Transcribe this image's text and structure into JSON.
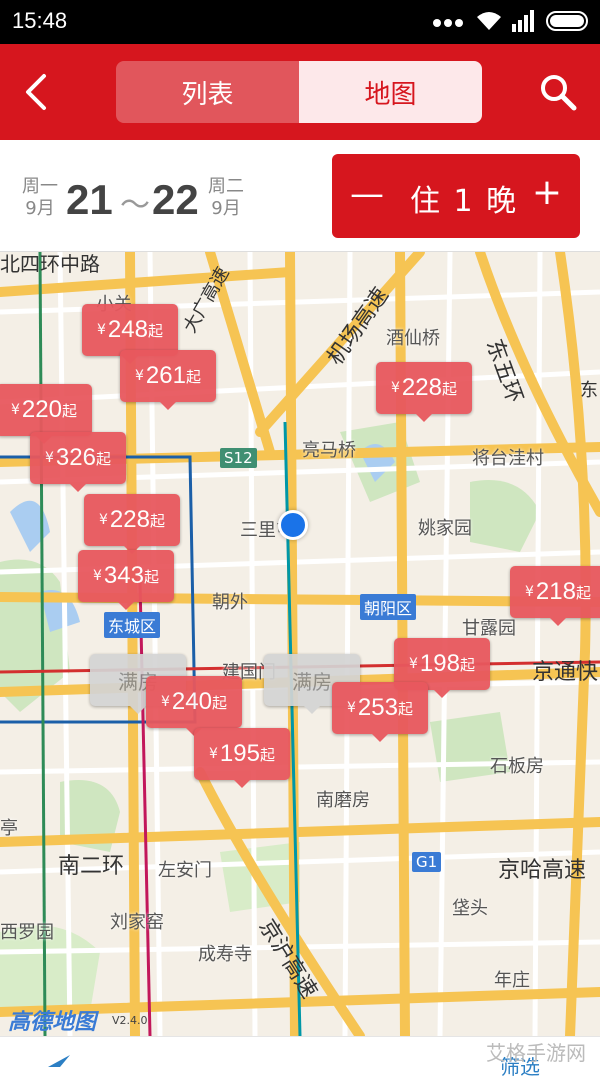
{
  "status_bar": {
    "time": "15:48"
  },
  "nav": {
    "tabs": [
      {
        "label": "列表",
        "selected": false
      },
      {
        "label": "地图",
        "selected": true
      }
    ]
  },
  "dates": {
    "checkin": {
      "weekday": "周一",
      "month": "9月",
      "day": "21"
    },
    "separator": "～",
    "checkout": {
      "weekday": "周二",
      "month": "9月",
      "day": "22"
    }
  },
  "nights": {
    "minus": "—",
    "label": "住 1 晚",
    "plus": "+"
  },
  "map": {
    "pins": [
      {
        "price": "248",
        "yen": "¥",
        "suffix": "起"
      },
      {
        "price": "261",
        "yen": "¥",
        "suffix": "起"
      },
      {
        "price": "228",
        "yen": "¥",
        "suffix": "起"
      },
      {
        "price": "220",
        "yen": "¥",
        "suffix": "起"
      },
      {
        "price": "326",
        "yen": "¥",
        "suffix": "起"
      },
      {
        "price": "228",
        "yen": "¥",
        "suffix": "起"
      },
      {
        "price": "343",
        "yen": "¥",
        "suffix": "起"
      },
      {
        "price": "218",
        "yen": "¥",
        "suffix": "起"
      },
      {
        "price": "198",
        "yen": "¥",
        "suffix": "起"
      },
      {
        "price": "240",
        "yen": "¥",
        "suffix": "起"
      },
      {
        "price": "253",
        "yen": "¥",
        "suffix": "起"
      },
      {
        "price": "195",
        "yen": "¥",
        "suffix": "起"
      }
    ],
    "full_pins": [
      {
        "label": "满房"
      },
      {
        "label": "满房"
      }
    ],
    "places": [
      "小关",
      "酒仙桥",
      "亮马桥",
      "将台洼村",
      "三里屯",
      "姚家园",
      "朝外",
      "甘露园",
      "建国门",
      "石板房",
      "南磨房",
      "左安门",
      "垡头",
      "刘家窑",
      "成寿寺",
      "年庄",
      "西罗园",
      "亭"
    ],
    "roads": [
      "北四环中路",
      "机场高速",
      "东五环",
      "大广高速",
      "京通快",
      "南二环",
      "京哈高速",
      "京沪高速",
      "东"
    ],
    "tags": [
      "S12",
      "朝阳区",
      "东城区",
      "G1"
    ],
    "logo": "高德地图",
    "version": "V2.4.0"
  },
  "bottom": {
    "watermark": "艾格手游网",
    "filter": "筛选"
  },
  "colors": {
    "brand_red": "#d6161e",
    "pin_red": "#e8585e",
    "full_gray": "#d4d4d4",
    "location_blue": "#1a73e8"
  }
}
